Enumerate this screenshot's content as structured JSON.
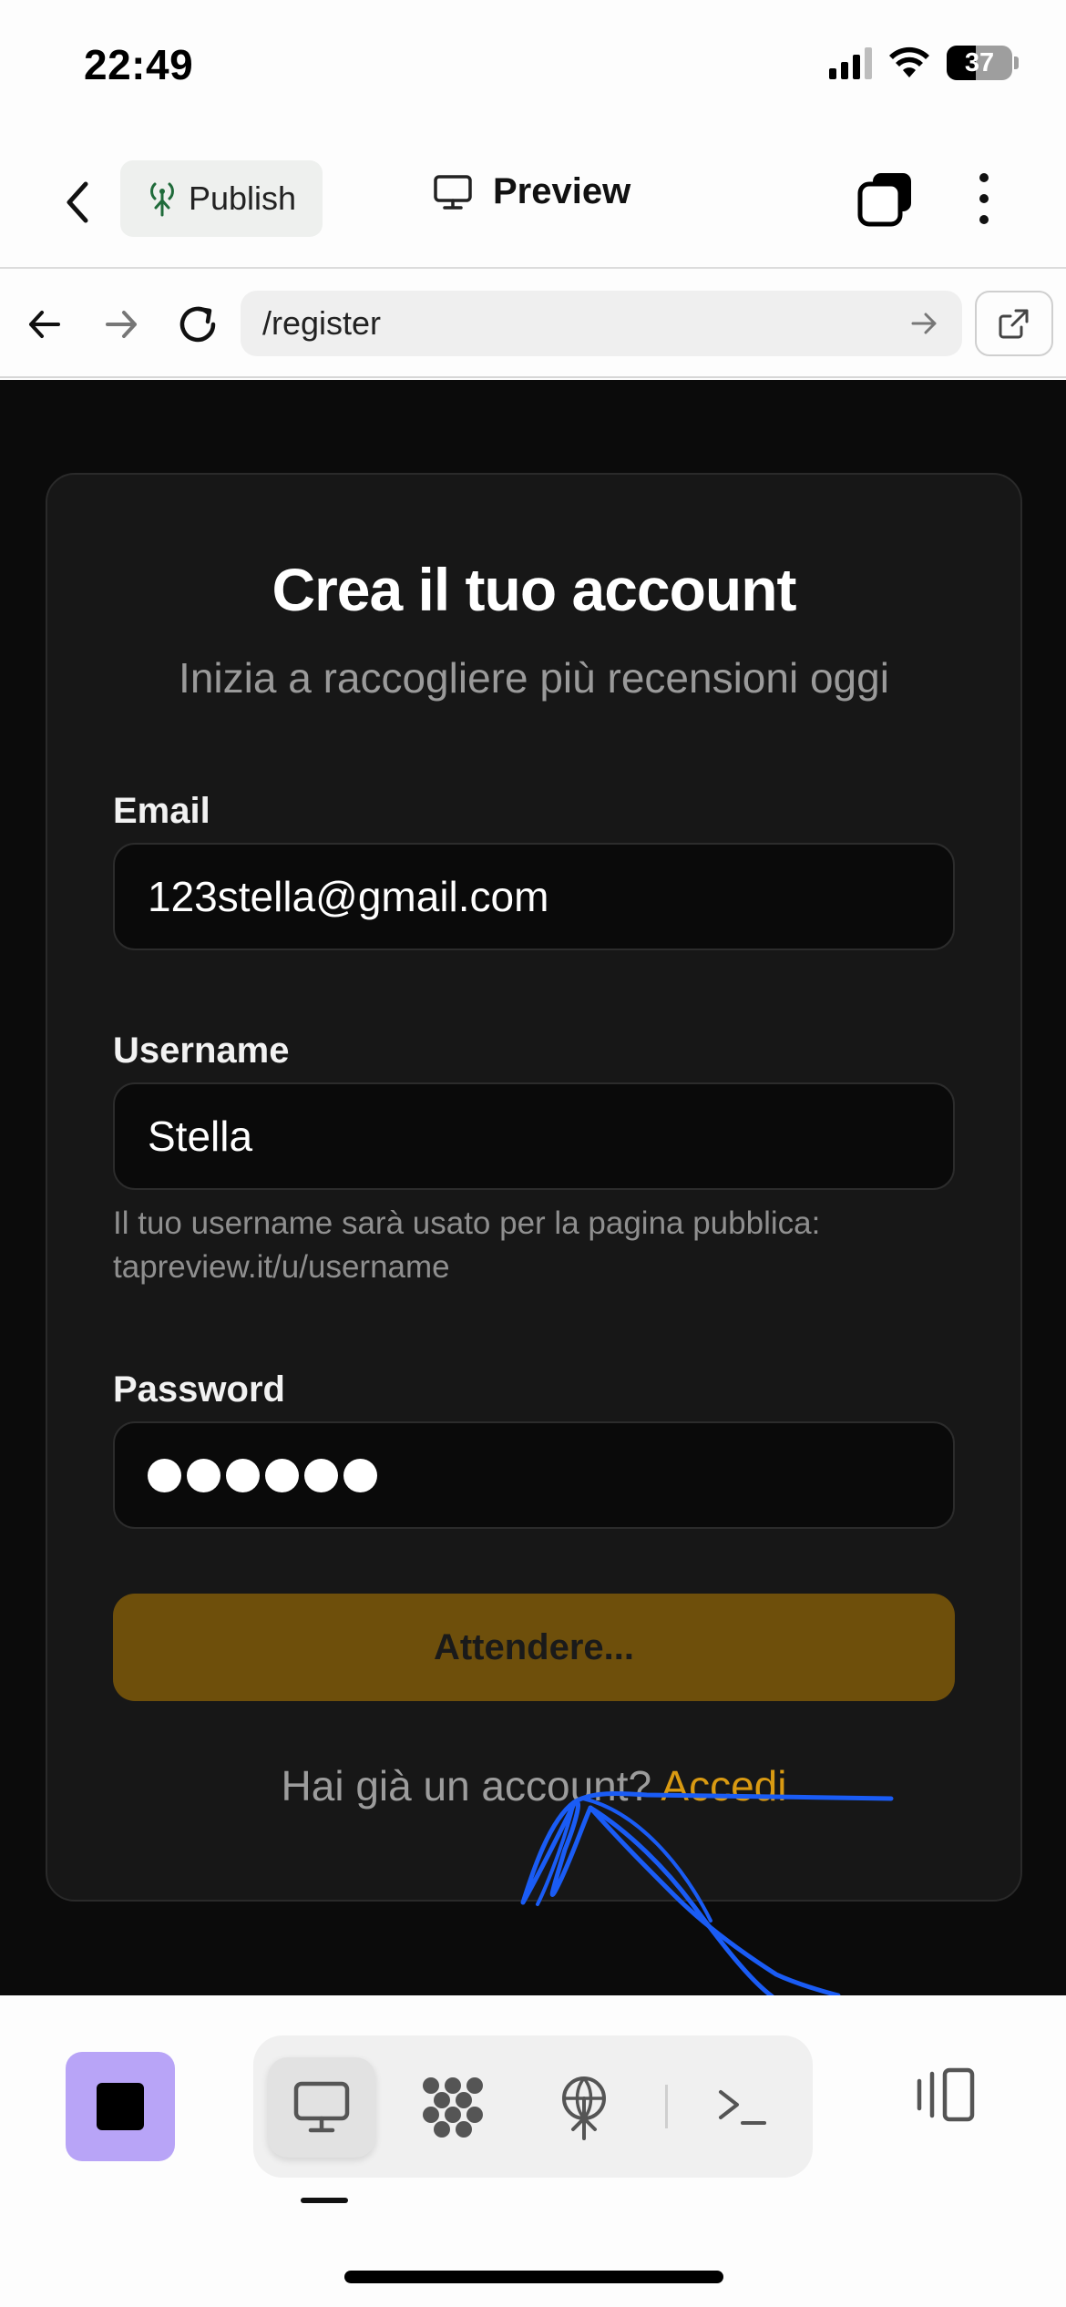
{
  "status_bar": {
    "time": "22:49",
    "battery": "37",
    "icons": [
      "signal-icon",
      "wifi-icon",
      "battery-icon"
    ]
  },
  "header": {
    "back_icon": "chevron-left-icon",
    "publish_label": "Publish",
    "publish_icon": "antenna-icon",
    "preview_label": "Preview",
    "preview_icon": "monitor-icon",
    "stack_icon": "stacked-squares-icon",
    "more_icon": "more-vertical-icon"
  },
  "browser": {
    "url": "/register",
    "icons": [
      "arrow-left-icon",
      "arrow-right-icon",
      "reload-icon",
      "go-arrow-icon",
      "external-link-icon"
    ]
  },
  "form": {
    "title": "Crea il tuo account",
    "subtitle": "Inizia a raccogliere più recensioni oggi",
    "email_label": "Email",
    "email_value": "123stella@gmail.com",
    "username_label": "Username",
    "username_value": "Stella",
    "username_hint_line1": "Il tuo username sarà usato per la pagina pubblica:",
    "username_hint_line2": "tapreview.it/u/username",
    "password_label": "Password",
    "password_mask_count": 6,
    "submit_label": "Attendere...",
    "login_prompt": "Hai già un account?",
    "login_link": "Accedi"
  },
  "toolbar": {
    "stop_icon": "stop-icon",
    "items": [
      "monitor-icon",
      "grid-flower-icon",
      "antenna-icon",
      "terminal-icon"
    ],
    "active_index": 0,
    "panel_icon": "side-panel-icon"
  },
  "colors": {
    "accent_button": "#6e4f0b",
    "link": "#d99a12",
    "stop_button": "#b8a4f7",
    "scribble": "#1a5cf5"
  }
}
